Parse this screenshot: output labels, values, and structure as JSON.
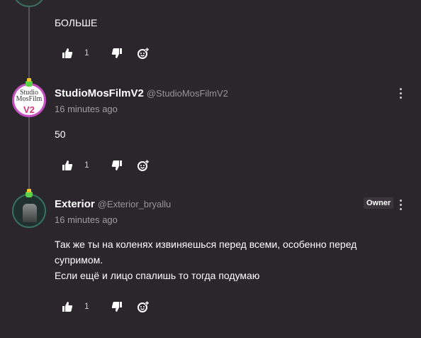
{
  "comments": [
    {
      "text": "БОЛЬШЕ",
      "likes": "1"
    },
    {
      "author": "StudioMosFilmV2",
      "handle": "@StudioMosFilmV2",
      "time": "16 minutes ago",
      "avatar_text_top": "Studio MosFilm",
      "avatar_text_bottom": "V2",
      "text": "50",
      "likes": "1"
    },
    {
      "author": "Exterior",
      "handle": "@Exterior_bryallu",
      "badge": "Owner",
      "time": "16 minutes ago",
      "text_lines": [
        "Так же ты на коленях извиняешься перед всеми, особенно перед",
        "супримом.",
        "Если ещё и лицо спалишь то тогда подумаю"
      ],
      "likes": "1"
    }
  ],
  "icons": {
    "like": "thumbs-up-icon",
    "dislike": "thumbs-down-icon",
    "react": "emoji-add-icon",
    "menu": "more-vertical-icon"
  },
  "colors": {
    "background": "#2b252c",
    "text": "#ffffff",
    "muted": "#a39ca5",
    "thread_line": "#57515a"
  }
}
